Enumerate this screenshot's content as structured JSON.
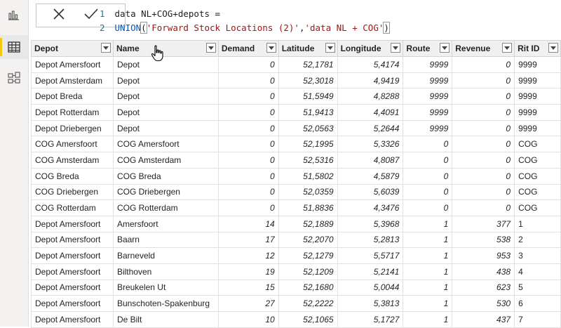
{
  "rail": {
    "items": [
      {
        "icon": "report-view-icon"
      },
      {
        "icon": "data-view-icon",
        "active": true
      },
      {
        "icon": "model-view-icon"
      }
    ]
  },
  "formula": {
    "line1_num": "1",
    "line1_text": "data NL+COG+depots =",
    "line2_num": "2",
    "line2_fn": "UNION",
    "line2_open": "(",
    "line2_arg1": "'Forward Stock Locations (2)'",
    "line2_sep": ",",
    "line2_arg2": "'data NL + COG'",
    "line2_close": ")"
  },
  "table": {
    "columns": [
      "Depot",
      "Name",
      "Demand",
      "Latitude",
      "Longitude",
      "Route",
      "Revenue",
      "Rit ID"
    ],
    "rows": [
      [
        "Depot Amersfoort",
        "Depot",
        "0",
        "52,1781",
        "5,4174",
        "9999",
        "0",
        "9999"
      ],
      [
        "Depot Amsterdam",
        "Depot",
        "0",
        "52,3018",
        "4,9419",
        "9999",
        "0",
        "9999"
      ],
      [
        "Depot Breda",
        "Depot",
        "0",
        "51,5949",
        "4,8288",
        "9999",
        "0",
        "9999"
      ],
      [
        "Depot Rotterdam",
        "Depot",
        "0",
        "51,9413",
        "4,4091",
        "9999",
        "0",
        "9999"
      ],
      [
        "Depot Driebergen",
        "Depot",
        "0",
        "52,0563",
        "5,2644",
        "9999",
        "0",
        "9999"
      ],
      [
        "COG Amersfoort",
        "COG Amersfoort",
        "0",
        "52,1995",
        "5,3326",
        "0",
        "0",
        "COG"
      ],
      [
        "COG Amsterdam",
        "COG Amsterdam",
        "0",
        "52,5316",
        "4,8087",
        "0",
        "0",
        "COG"
      ],
      [
        "COG Breda",
        "COG Breda",
        "0",
        "51,5802",
        "4,5879",
        "0",
        "0",
        "COG"
      ],
      [
        "COG Driebergen",
        "COG Driebergen",
        "0",
        "52,0359",
        "5,6039",
        "0",
        "0",
        "COG"
      ],
      [
        "COG Rotterdam",
        "COG Rotterdam",
        "0",
        "51,8836",
        "4,3476",
        "0",
        "0",
        "COG"
      ],
      [
        "Depot Amersfoort",
        "Amersfoort",
        "14",
        "52,1889",
        "5,3968",
        "1",
        "377",
        "1"
      ],
      [
        "Depot Amersfoort",
        "Baarn",
        "17",
        "52,2070",
        "5,2813",
        "1",
        "538",
        "2"
      ],
      [
        "Depot Amersfoort",
        "Barneveld",
        "12",
        "52,1279",
        "5,5717",
        "1",
        "953",
        "3"
      ],
      [
        "Depot Amersfoort",
        "Bilthoven",
        "19",
        "52,1209",
        "5,2141",
        "1",
        "438",
        "4"
      ],
      [
        "Depot Amersfoort",
        "Breukelen Ut",
        "15",
        "52,1680",
        "5,0044",
        "1",
        "623",
        "5"
      ],
      [
        "Depot Amersfoort",
        "Bunschoten-Spakenburg",
        "27",
        "52,2222",
        "5,3813",
        "1",
        "530",
        "6"
      ],
      [
        "Depot Amersfoort",
        "De Bilt",
        "10",
        "52,1065",
        "5,1727",
        "1",
        "437",
        "7"
      ]
    ]
  }
}
